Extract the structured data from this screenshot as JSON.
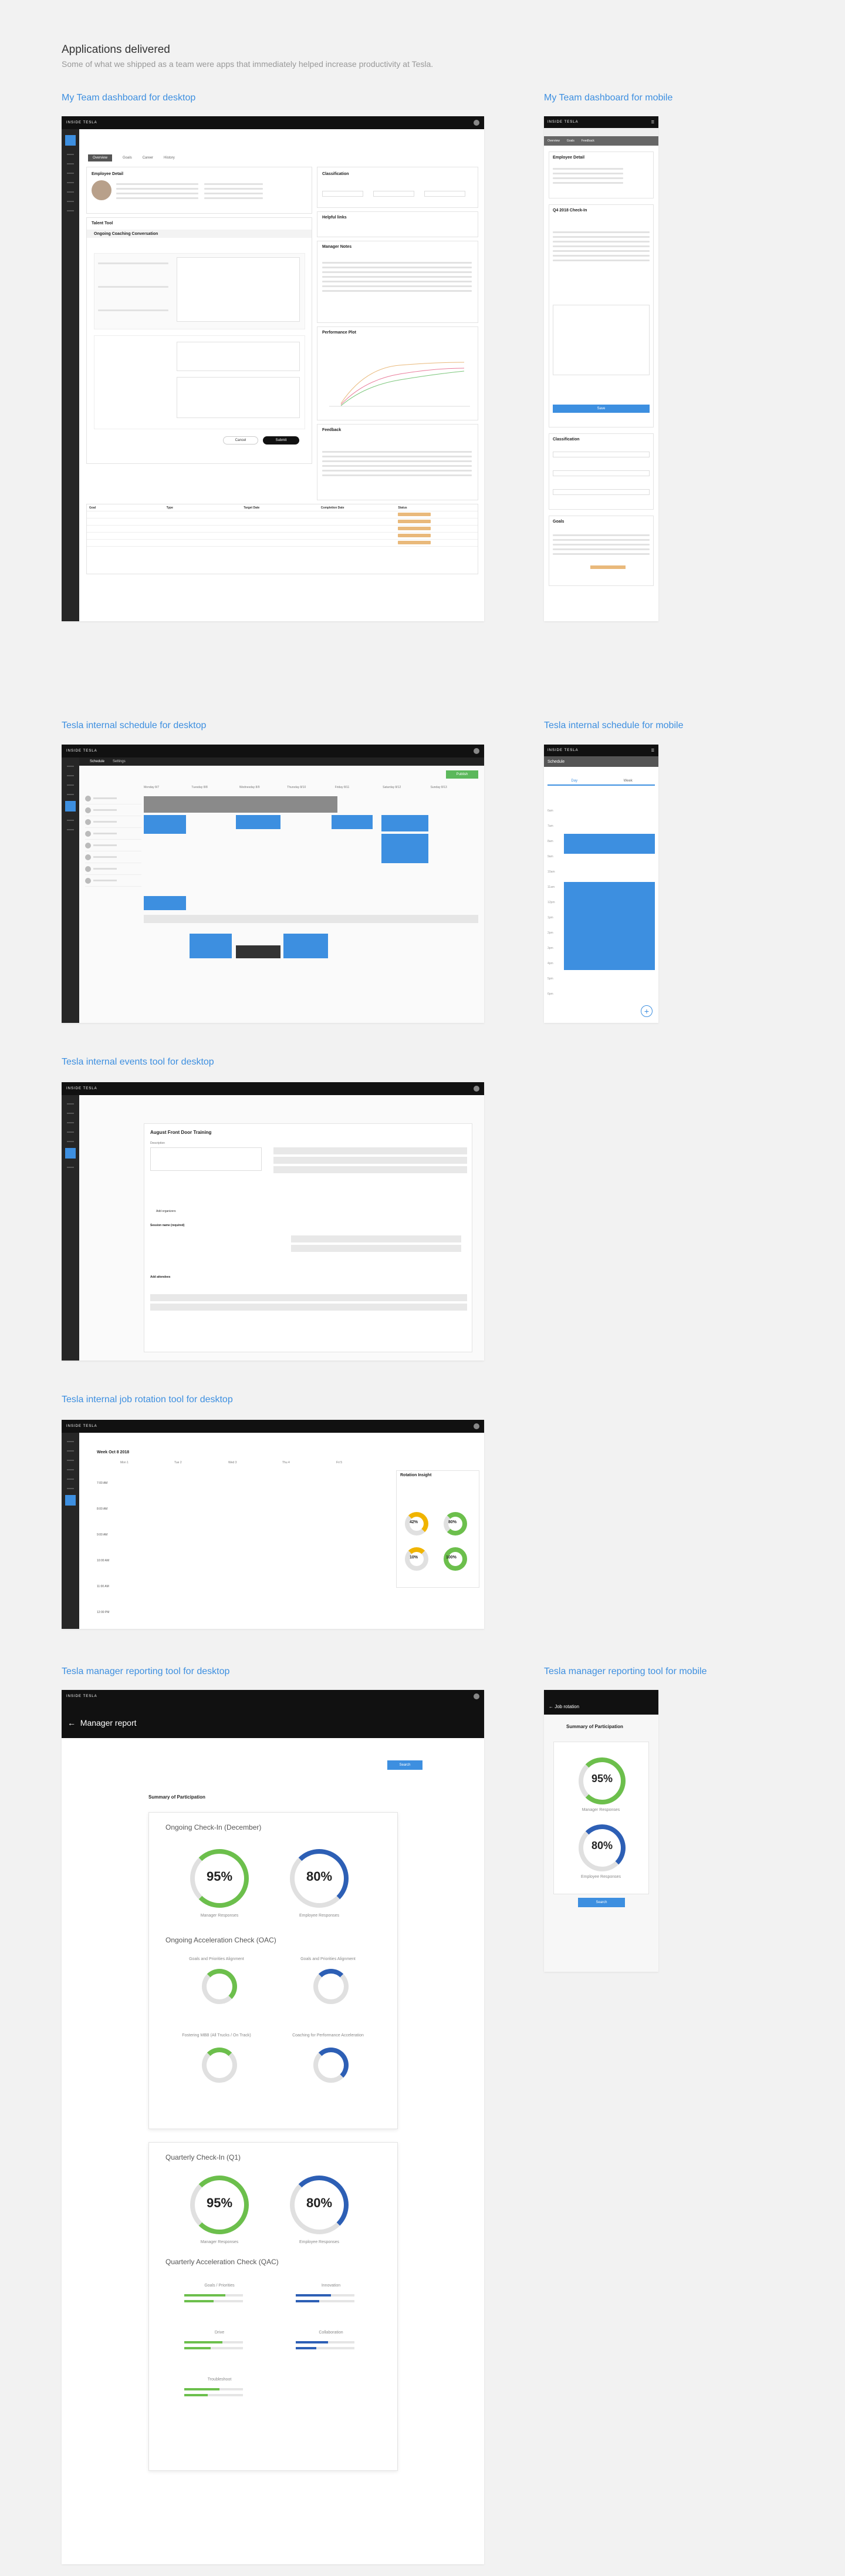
{
  "header": {
    "title": "Applications delivered",
    "subtitle": "Some of what we shipped as a team were apps that immediately helped increase productivity at Tesla."
  },
  "sections": {
    "team_desktop": "My Team dashboard for desktop",
    "team_mobile": "My Team dashboard for mobile",
    "schedule_desktop": "Tesla internal schedule for desktop",
    "schedule_mobile": "Tesla internal schedule for mobile",
    "events_desktop": "Tesla internal events tool for desktop",
    "rotation_desktop": "Tesla internal job rotation tool for desktop",
    "report_desktop": "Tesla manager reporting tool for desktop",
    "report_mobile": "Tesla manager reporting tool for mobile"
  },
  "brand": {
    "name": "INSIDE TESLA",
    "accent": "#3d8fe0",
    "topbar": "#111111"
  },
  "team": {
    "tabs": [
      "Overview",
      "Goals",
      "Career",
      "History"
    ],
    "employee_detail": "Employee Detail",
    "classification": "Classification",
    "helpful_links": "Helpful links",
    "manager_notes": "Manager Notes",
    "talent_tool": "Talent Tool",
    "coaching": "Ongoing Coaching Conversation",
    "performance_plot": "Performance Plot",
    "feedback": "Feedback",
    "cancel": "Cancel",
    "submit": "Submit",
    "table_headers": [
      "Goal",
      "Type",
      "Target Date",
      "Completion Date",
      "Status"
    ]
  },
  "team_mobile": {
    "tabs": [
      "Overview",
      "Goals",
      "Feedback"
    ],
    "employee_detail": "Employee Detail",
    "checkin": "Q4 2018 Check-In",
    "classification": "Classification",
    "goals": "Goals",
    "save": "Save"
  },
  "schedule": {
    "tabs": [
      "Schedule",
      "Settings"
    ],
    "days": [
      "Monday 8/7",
      "Tuesday 8/8",
      "Wednesday 8/9",
      "Thursday 8/10",
      "Friday 8/11",
      "Saturday 8/12",
      "Sunday 8/13"
    ],
    "publish": "Publish"
  },
  "schedule_mobile": {
    "title": "Schedule",
    "day_tab": "Day",
    "week_tab": "Week",
    "hours": [
      "6am",
      "7am",
      "8am",
      "9am",
      "10am",
      "11am",
      "12pm",
      "1pm",
      "2pm",
      "3pm",
      "4pm",
      "5pm",
      "6pm"
    ]
  },
  "events": {
    "event_title": "August Front Door Training",
    "description": "Description",
    "add_organizers": "Add organizers",
    "session_name": "Session name (required)",
    "add_attendees": "Add attendees"
  },
  "rotation": {
    "week": "Week Oct 8 2018",
    "days": [
      "Mon 1",
      "Tue 2",
      "Wed 3",
      "Thu 4",
      "Fri 5"
    ],
    "times": [
      "7:00 AM",
      "8:00 AM",
      "9:00 AM",
      "10:00 AM",
      "11:00 AM",
      "12:00 PM"
    ],
    "panel_title": "Rotation Insight",
    "gauges": [
      "42%",
      "80%",
      "10%",
      "100%"
    ]
  },
  "report": {
    "title": "Manager report",
    "summary": "Summary of Participation",
    "ongoing_checkin": "Ongoing Check-In (December)",
    "ongoing_acc": "Ongoing Acceleration Check (OAC)",
    "quarterly_checkin": "Quarterly Check-In (Q1)",
    "quarterly_acc": "Quarterly Acceleration Check (QAC)",
    "manager_pct": "95%",
    "employee_pct": "80%",
    "manager_label": "Manager Responses",
    "employee_label": "Employee Responses",
    "manager_value": 0.95,
    "employee_value": 0.8,
    "search": "Search",
    "oac_items": [
      "Goals and Priorities Alignment",
      "Goals and Priorities Alignment",
      "Fostering MBB (All Trucks / On Track)",
      "Coaching for Performance Acceleration"
    ],
    "qac_items": [
      "Goals / Priorities",
      "Innovation",
      "Drive",
      "Collaboration",
      "Troubleshoot"
    ]
  },
  "report_mobile": {
    "title": "Job rotation",
    "summary": "Summary of Participation",
    "manager_pct": "95%",
    "employee_pct": "80%",
    "manager_label": "Manager Responses",
    "employee_label": "Employee Responses",
    "search": "Search"
  }
}
